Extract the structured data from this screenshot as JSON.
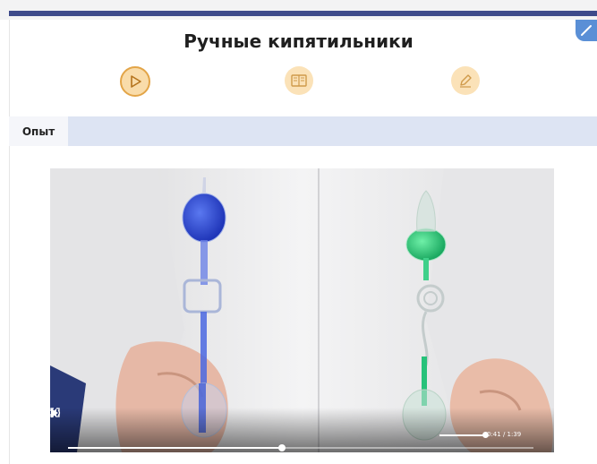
{
  "lesson": {
    "title": "Ручные кипятильники"
  },
  "toolbar": [
    {
      "name": "video",
      "icon": "play-icon",
      "active": true
    },
    {
      "name": "book",
      "icon": "book-icon",
      "active": false
    },
    {
      "name": "edit",
      "icon": "pencil-icon",
      "active": false
    }
  ],
  "tabs": {
    "active_label": "Опыт"
  },
  "video": {
    "time": "0:41 / 1:39",
    "progress": 0.46,
    "volume": 0.9
  },
  "colors": {
    "header_bar": "#3d4a8a",
    "accent": "#e3a548",
    "tab_strip": "#dde4f3",
    "corner_button": "#5a8fd6",
    "blue_liquid": "#2f4fd1",
    "green_liquid": "#27c27a"
  }
}
